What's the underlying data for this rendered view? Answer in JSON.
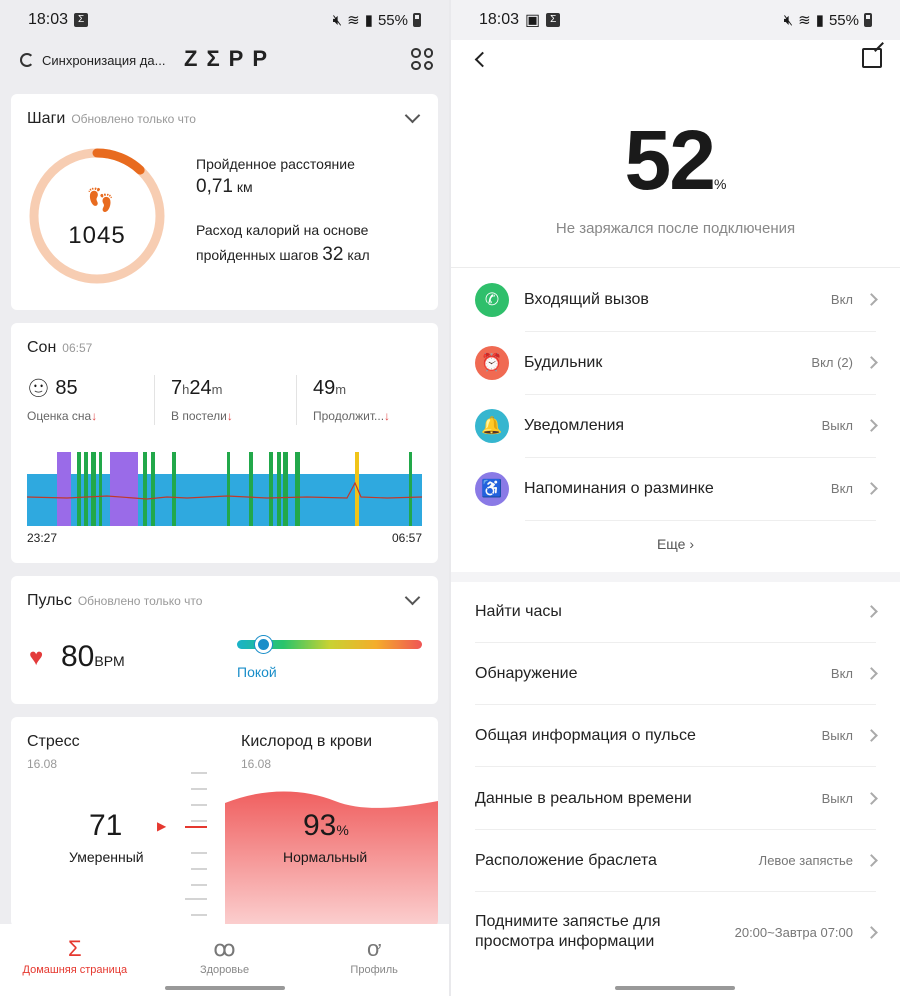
{
  "left": {
    "status": {
      "time": "18:03",
      "notif_glyph": "Σ",
      "battery": "55%"
    },
    "header": {
      "sync_text": "Синхронизация да...",
      "logo": "ZΣPP"
    },
    "steps": {
      "title": "Шаги",
      "updated": "Обновлено только что",
      "count": "1045",
      "distance_label": "Пройденное расстояние",
      "distance_value": "0,71",
      "distance_unit": "км",
      "calories_label_1": "Расход калорий на основе",
      "calories_label_2": "пройденных шагов",
      "calories_value": "32",
      "calories_unit": "кал",
      "progress": 0.12
    },
    "sleep": {
      "title": "Сон",
      "time": "06:57",
      "score": "85",
      "score_label": "Оценка сна",
      "bed_h": "7",
      "bed_h_unit": "h",
      "bed_m": "24",
      "bed_m_unit": "m",
      "bed_label": "В постели",
      "dur_m": "49",
      "dur_unit": "m",
      "dur_label": "Продолжит...",
      "start": "23:27",
      "end": "06:57"
    },
    "pulse": {
      "title": "Пульс",
      "updated": "Обновлено только что",
      "value": "80",
      "unit": "BPM",
      "zone": "Покой"
    },
    "stress": {
      "title": "Стресс",
      "date": "16.08",
      "value": "71",
      "label": "Умеренный"
    },
    "oxygen": {
      "title": "Кислород в крови",
      "date": "16.08",
      "value": "93",
      "unit": "%",
      "label": "Нормальный"
    },
    "nav": [
      {
        "icon": "Σ",
        "label": "Домашняя страница"
      },
      {
        "icon": "ꝏ",
        "label": "Здоровье"
      },
      {
        "icon": "ơ",
        "label": "Профиль"
      }
    ],
    "colors": {
      "accent": "#e5382f",
      "steps_orange": "#e86b1f",
      "ring_track": "#f7cdb2"
    }
  },
  "right": {
    "status": {
      "time": "18:03",
      "battery": "55%"
    },
    "battery_percent": "52",
    "battery_unit": "%",
    "battery_note": "Не заряжался после подключения",
    "items": [
      {
        "label": "Входящий вызов",
        "value": "Вкл",
        "icon": "phone-icon",
        "color": "#2fbf6b",
        "glyph": "✆"
      },
      {
        "label": "Будильник",
        "value": "Вкл (2)",
        "icon": "alarm-icon",
        "color": "#f06a52",
        "glyph": "⏰"
      },
      {
        "label": "Уведомления",
        "value": "Выкл",
        "icon": "bell-icon",
        "color": "#36b6cf",
        "glyph": "🔔"
      },
      {
        "label": "Напоминания о разминке",
        "value": "Вкл",
        "icon": "chair-icon",
        "color": "#8a7ae6",
        "glyph": "♿"
      }
    ],
    "more": "Еще",
    "settings": [
      {
        "label": "Найти часы",
        "value": ""
      },
      {
        "label": "Обнаружение",
        "value": "Вкл"
      },
      {
        "label": "Общая информация о пульсе",
        "value": "Выкл"
      },
      {
        "label": "Данные в реальном времени",
        "value": "Выкл"
      },
      {
        "label": "Расположение браслета",
        "value": "Левое запястье"
      },
      {
        "label": "Поднимите запястье для просмотра информации",
        "value": "20:00~Завтра 07:00"
      }
    ]
  }
}
